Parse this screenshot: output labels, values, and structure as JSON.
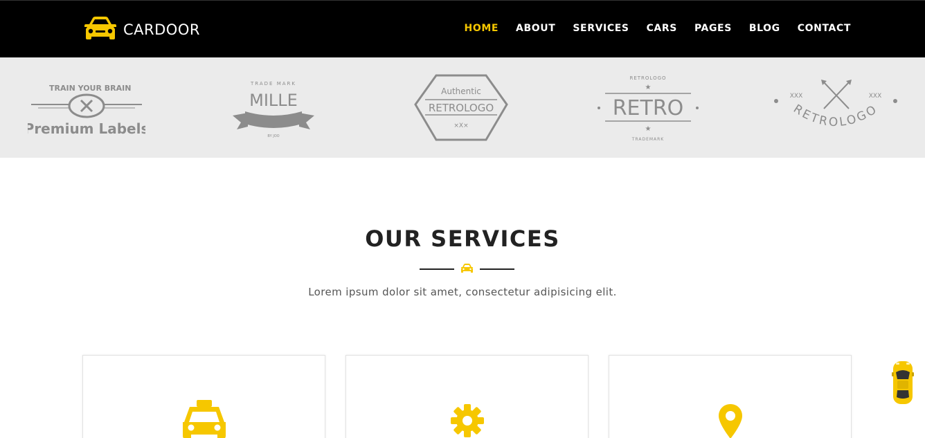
{
  "brand": {
    "name": "CARDOOR",
    "logo_icon": "car-front-icon"
  },
  "nav": {
    "items": [
      {
        "label": "HOME",
        "active": true
      },
      {
        "label": "ABOUT"
      },
      {
        "label": "SERVICES"
      },
      {
        "label": "CARS"
      },
      {
        "label": "PAGES"
      },
      {
        "label": "BLOG"
      },
      {
        "label": "CONTACT"
      }
    ]
  },
  "clients": {
    "logos": [
      {
        "line1": "TRAIN YOUR BRAIN",
        "line2": "Premium Labels"
      },
      {
        "top": "TRADE MARK",
        "main": "MILLE",
        "bottom": "BY JOO"
      },
      {
        "top": "Authentic",
        "main": "RETROLOGO",
        "bottom": "×X×"
      },
      {
        "top": "RETROLOGO",
        "main": "RETRO",
        "bottom": "TRADEMARK"
      },
      {
        "main": "RETROLOGO",
        "marks": "XXX"
      }
    ]
  },
  "services_section": {
    "title": "OUR SERVICES",
    "subtitle": "Lorem ipsum dolor sit amet, consectetur adipisicing elit.",
    "divider_icon": "car-icon",
    "cards": [
      {
        "icon": "taxi-icon"
      },
      {
        "icon": "gear-icon"
      },
      {
        "icon": "map-marker-icon"
      }
    ]
  },
  "floating": {
    "icon": "car-top-view-icon"
  },
  "colors": {
    "accent": "#f6c700",
    "header_bg": "#000000",
    "strip_bg": "#ebebeb",
    "logo_grey": "#8c8c8c"
  }
}
